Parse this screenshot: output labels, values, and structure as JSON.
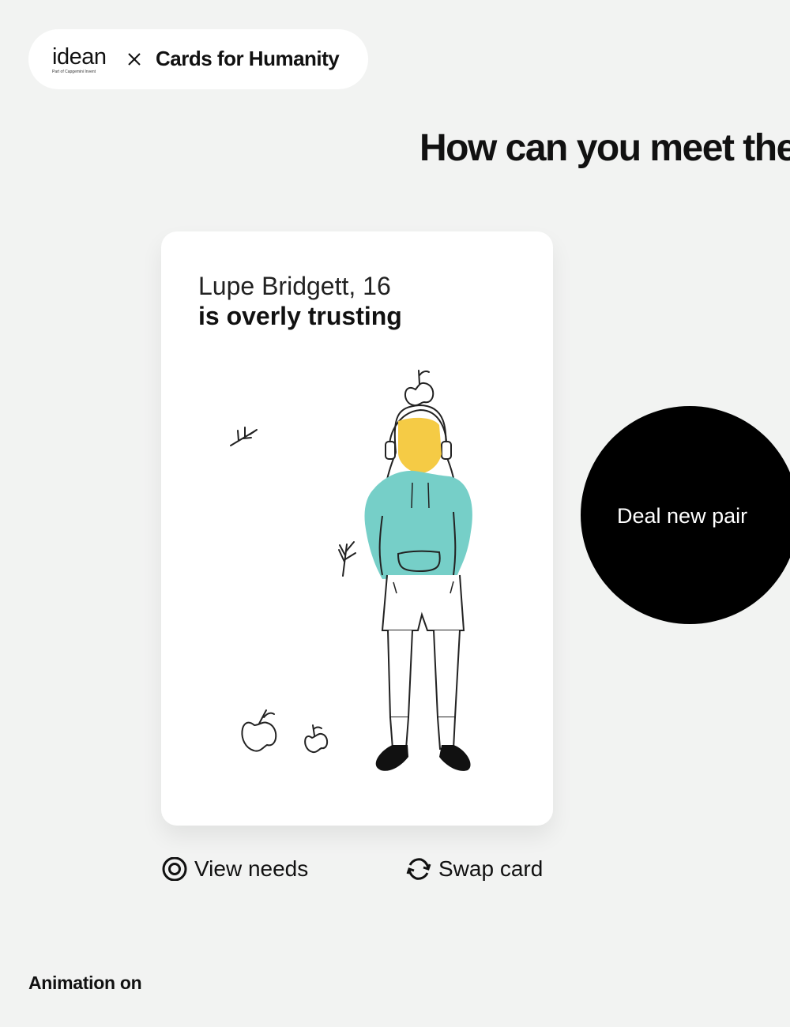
{
  "brand": {
    "logo_text": "idean",
    "logo_subtext": "Part of Capgemini Invent",
    "separator": "×",
    "product_name": "Cards for Humanity"
  },
  "headline": "How can you meet the",
  "card": {
    "persona_name": "Lupe Bridgett, 16",
    "persona_trait": "is overly trusting",
    "illustration_icons": [
      "plant-sprig-icon",
      "apple-icon",
      "person-figure"
    ]
  },
  "actions": {
    "view_needs": "View needs",
    "view_needs_icon": "eye-icon",
    "swap_card": "Swap card",
    "swap_card_icon": "refresh-icon"
  },
  "deal_button": "Deal new pair",
  "animation_toggle": "Animation on",
  "colors": {
    "background": "#f2f3f2",
    "hair": "#f5cb45",
    "hoodie": "#76cfc8",
    "button": "#000000"
  }
}
